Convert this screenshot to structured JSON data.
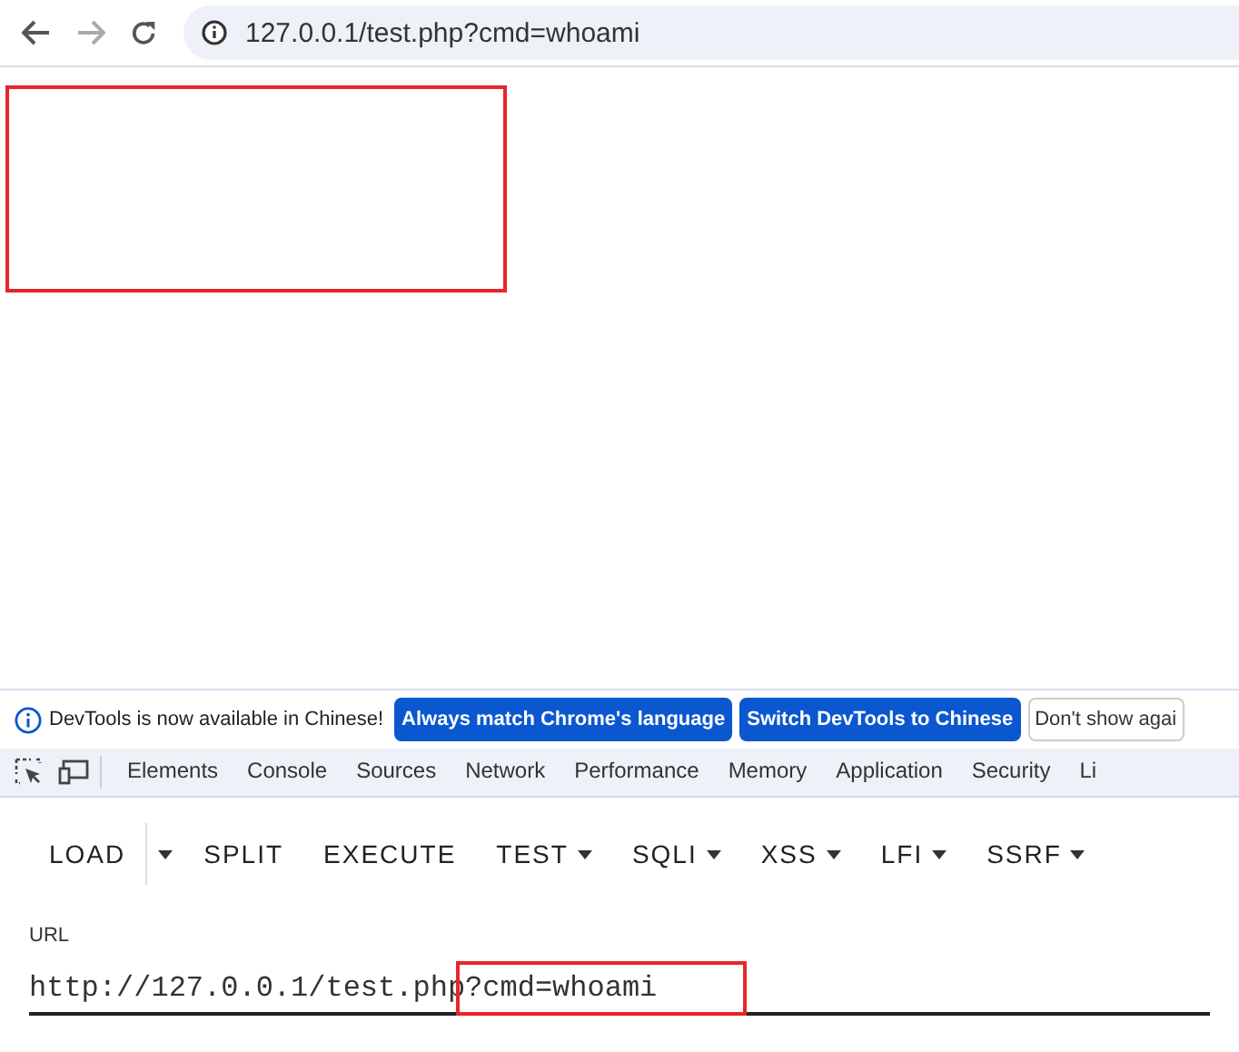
{
  "browser": {
    "address": "127.0.0.1/test.php?cmd=whoami"
  },
  "page": {
    "annotations": [
      {
        "kind": "highlight"
      }
    ]
  },
  "devtools": {
    "notice": "DevTools is now available in Chinese!",
    "notice_buttons": [
      {
        "label": "Always match Chrome's language",
        "kind": "primary"
      },
      {
        "label": "Switch DevTools to Chinese",
        "kind": "primary"
      },
      {
        "label": "Don't show agai",
        "kind": "plain"
      }
    ],
    "tabs": [
      {
        "label": "Elements",
        "selected": false
      },
      {
        "label": "Console",
        "selected": false
      },
      {
        "label": "Sources",
        "selected": false
      },
      {
        "label": "Network",
        "selected": false
      },
      {
        "label": "Performance",
        "selected": false
      },
      {
        "label": "Memory",
        "selected": false
      },
      {
        "label": "Application",
        "selected": false
      },
      {
        "label": "Security",
        "selected": false
      },
      {
        "label": "Li",
        "selected": false
      }
    ]
  },
  "hackbar": {
    "buttons": [
      {
        "label": "LOAD",
        "kind": "split"
      },
      {
        "label": "SPLIT",
        "kind": "plain"
      },
      {
        "label": "EXECUTE",
        "kind": "plain"
      },
      {
        "label": "TEST",
        "kind": "menu"
      },
      {
        "label": "SQLI",
        "kind": "menu"
      },
      {
        "label": "XSS",
        "kind": "menu"
      },
      {
        "label": "LFI",
        "kind": "menu"
      },
      {
        "label": "SSRF",
        "kind": "menu"
      }
    ],
    "url_label": "URL",
    "url_value": "http://127.0.0.1/test.php?cmd=whoami",
    "url_annotation": {
      "kind": "highlight"
    }
  }
}
